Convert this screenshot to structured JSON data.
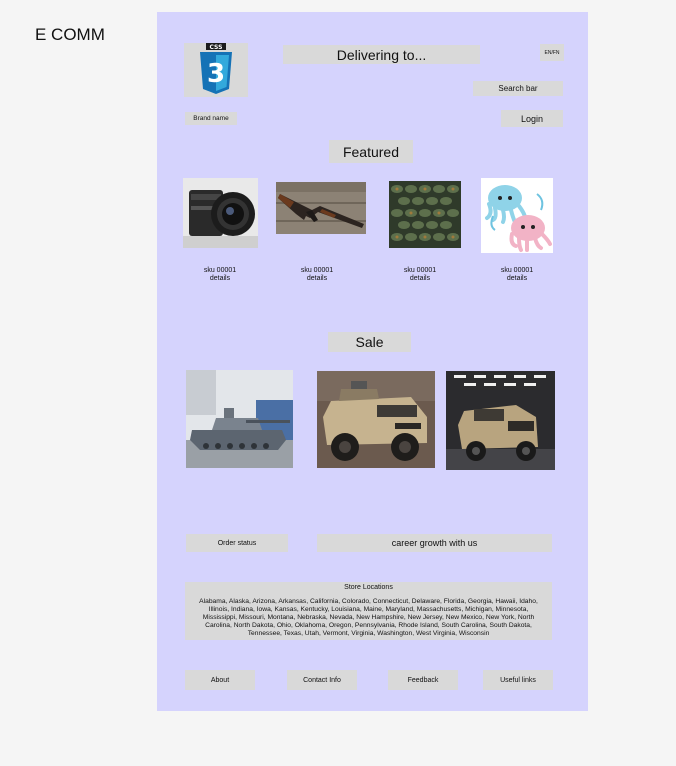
{
  "app": {
    "frame_title": "E COMM"
  },
  "header": {
    "delivering": "Delivering to...",
    "language": "EN/FN",
    "search": "Search bar",
    "brand": "Brand name",
    "login": "Login",
    "logo_text": "CSS",
    "logo_number": "3"
  },
  "featured": {
    "heading": "Featured",
    "items": [
      {
        "sku": "sku 00001",
        "details": "details",
        "image": "camera-lens"
      },
      {
        "sku": "sku 00001",
        "details": "details",
        "image": "rifle"
      },
      {
        "sku": "sku 00001",
        "details": "details",
        "image": "ammunition"
      },
      {
        "sku": "sku 00001",
        "details": "details",
        "image": "octopus-plush"
      }
    ]
  },
  "sale": {
    "heading": "Sale",
    "items": [
      {
        "image": "tank"
      },
      {
        "image": "armored-vehicle-tan"
      },
      {
        "image": "armored-truck-showroom"
      }
    ]
  },
  "mid": {
    "order_status": "Order status",
    "career": "career growth with us"
  },
  "store_locations": {
    "title": "Store Locations",
    "text": "Alabama, Alaska, Arizona, Arkansas, California, Colorado, Connecticut, Delaware, Florida, Georgia, Hawaii, Idaho, Illinois, Indiana, Iowa, Kansas, Kentucky, Louisiana, Maine, Maryland, Massachusetts, Michigan, Minnesota, Mississippi, Missouri, Montana, Nebraska, Nevada, New Hampshire, New Jersey, New Mexico, New York, North Carolina, North Dakota, Ohio, Oklahoma, Oregon, Pennsylvania, Rhode Island, South Carolina, South Dakota, Tennessee, Texas, Utah, Vermont, Virginia, Washington, West Virginia, Wisconsin"
  },
  "footer": {
    "about": "About",
    "contact": "Contact Info",
    "feedback": "Feedback",
    "useful": "Useful links"
  },
  "colors": {
    "page_bg": "#f5f5f5",
    "frame_bg": "#d5d3fd",
    "box_bg": "#d9d9d9",
    "css_blue": "#1572b6",
    "css_light": "#33a9dc"
  }
}
